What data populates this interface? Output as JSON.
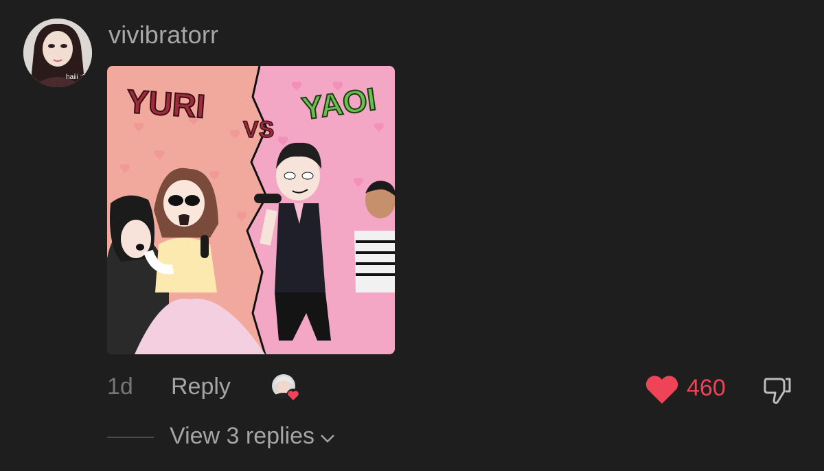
{
  "comment": {
    "username": "vivibratorr",
    "avatar_caption": "haiii :3",
    "image": {
      "left_title": "YURI",
      "vs_text": "VS",
      "right_title": "YAOI",
      "colors": {
        "left_bg": "#f2a99d",
        "right_bg": "#f4a7c5",
        "left_text": "#9f2c3d",
        "right_text": "#6abd4f"
      }
    },
    "timestamp": "1d",
    "reply_label": "Reply",
    "like_count": "460",
    "view_replies_label": "View 3 replies",
    "colors": {
      "like": "#ef4358",
      "background": "#1e1e1e"
    }
  }
}
